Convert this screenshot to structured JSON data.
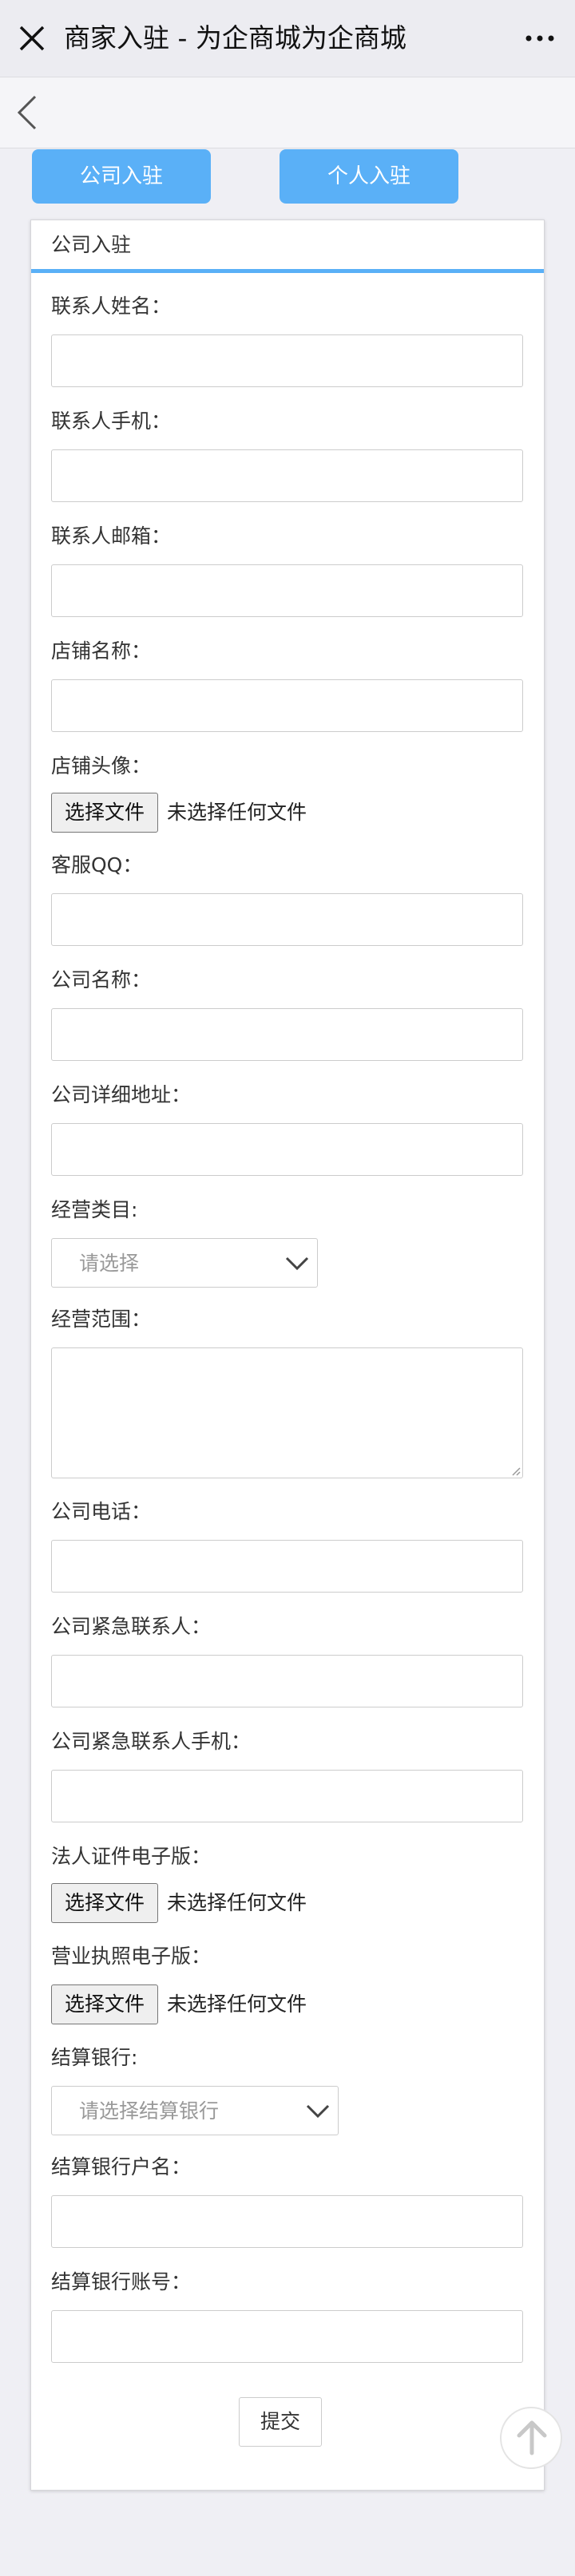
{
  "topbar": {
    "title": "商家入驻 - 为企商城为企商城"
  },
  "tabs": {
    "company": "公司入驻",
    "personal": "个人入驻"
  },
  "form": {
    "header": "公司入驻",
    "contact_name": "联系人姓名：",
    "contact_phone": "联系人手机：",
    "contact_email": "联系人邮箱：",
    "shop_name": "店铺名称：",
    "shop_avatar": "店铺头像：",
    "file_button": "选择文件",
    "file_none": "未选择任何文件",
    "service_qq": "客服QQ：",
    "company_name": "公司名称：",
    "company_address": "公司详细地址：",
    "business_category": "经营类目:",
    "category_placeholder": "请选择",
    "business_scope": "经营范围：",
    "company_phone": "公司电话：",
    "emergency_contact": "公司紧急联系人：",
    "emergency_phone": "公司紧急联系人手机：",
    "legal_id": "法人证件电子版：",
    "license": "营业执照电子版：",
    "bank": "结算银行:",
    "bank_placeholder": "请选择结算银行",
    "account_name": "结算银行户名：",
    "account_no": "结算银行账号：",
    "submit": "提交"
  }
}
